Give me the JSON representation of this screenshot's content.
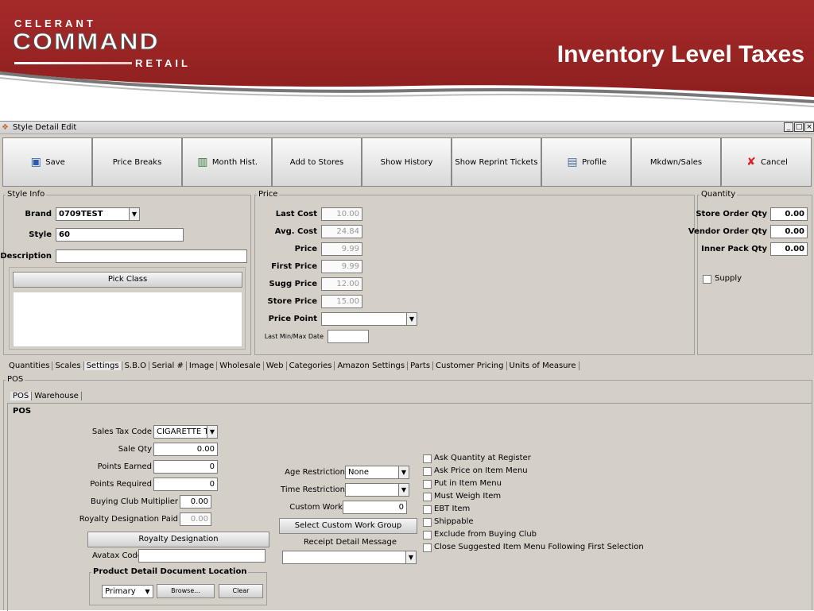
{
  "header": {
    "logo_top": "CELERANT",
    "logo_main": "COMMAND",
    "logo_bottom": "RETAIL",
    "slide_title": "Inventory Level Taxes",
    "banner_color": "#a52a2a"
  },
  "window": {
    "title": "Style Detail Edit",
    "controls": [
      "_",
      "□",
      "×"
    ]
  },
  "toolbar": {
    "save": "Save",
    "price_breaks": "Price Breaks",
    "month_hist": "Month Hist.",
    "add_to_stores": "Add to Stores",
    "show_history": "Show History",
    "show_reprint": "Show Reprint Tickets",
    "profile": "Profile",
    "mkdwn": "Mkdwn/Sales",
    "cancel": "Cancel"
  },
  "style_info": {
    "legend": "Style Info",
    "brand_label": "Brand",
    "brand_value": "0709TEST",
    "style_label": "Style",
    "style_value": "60",
    "description_label": "Description",
    "description_value": "",
    "pick_class": "Pick Class"
  },
  "price": {
    "legend": "Price",
    "last_cost_label": "Last Cost",
    "last_cost": "10.00",
    "avg_cost_label": "Avg. Cost",
    "avg_cost": "24.84",
    "price_label": "Price",
    "price": "9.99",
    "first_price_label": "First Price",
    "first_price": "9.99",
    "sugg_price_label": "Sugg Price",
    "sugg_price": "12.00",
    "store_price_label": "Store Price",
    "store_price": "15.00",
    "price_point_label": "Price Point",
    "price_point": "",
    "last_minmax_label": "Last Min/Max Date",
    "last_minmax": ""
  },
  "quantity": {
    "legend": "Quantity",
    "store_order_label": "Store Order Qty",
    "store_order": "0.00",
    "vendor_order_label": "Vendor Order Qty",
    "vendor_order": "0.00",
    "inner_pack_label": "Inner Pack Qty",
    "inner_pack": "0.00",
    "supply_label": "Supply"
  },
  "main_tabs": [
    "Quantities",
    "Scales",
    "Settings",
    "S.B.O",
    "Serial #",
    "Image",
    "Wholesale",
    "Web",
    "Categories",
    "Amazon Settings",
    "Parts",
    "Customer Pricing",
    "Units of Measure"
  ],
  "pos_panel": {
    "legend": "POS",
    "sub_tabs": [
      "POS",
      "Warehouse"
    ],
    "section_title": "POS",
    "sales_tax_code_label": "Sales Tax Code",
    "sales_tax_code": "CIGARETTE T/",
    "sale_qty_label": "Sale Qty",
    "sale_qty": "0.00",
    "points_earned_label": "Points Earned",
    "points_earned": "0",
    "points_required_label": "Points Required",
    "points_required": "0",
    "buying_club_label": "Buying Club Multiplier",
    "buying_club": "0.00",
    "royalty_paid_label": "Royalty Designation Paid",
    "royalty_paid": "0.00",
    "royalty_button": "Royalty Designation",
    "avatax_label": "Avatax Code",
    "avatax": "",
    "pdd_legend": "Product Detail Document Location",
    "pdd_select": "Primary",
    "browse": "Browse...",
    "clear": "Clear",
    "age_label": "Age Restriction",
    "age_value": "None",
    "time_label": "Time Restriction",
    "time_value": "",
    "custom_work_label": "Custom Work",
    "custom_work": "0",
    "select_custom_work": "Select Custom Work Group",
    "receipt_label": "Receipt Detail Message",
    "receipt_value": "",
    "checkboxes": [
      "Ask Quantity at Register",
      "Ask Price on Item Menu",
      "Put in Item Menu",
      "Must Weigh Item",
      "EBT Item",
      "Shippable",
      "Exclude from Buying Club",
      "Close Suggested Item Menu Following First Selection"
    ]
  }
}
